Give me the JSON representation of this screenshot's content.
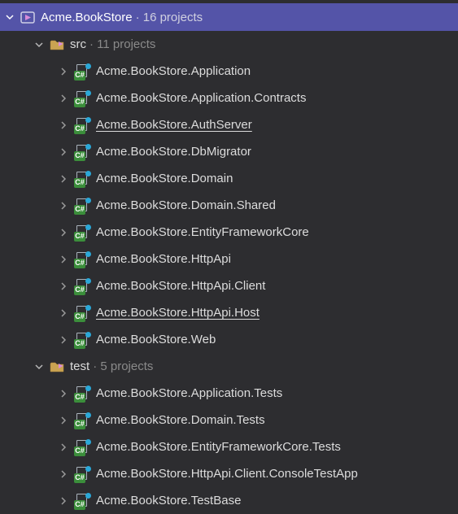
{
  "solution": {
    "name": "Acme.BookStore",
    "count_label": "16 projects"
  },
  "folders": [
    {
      "key": "src",
      "name": "src",
      "count_label": "11 projects",
      "expanded": true,
      "projects": [
        {
          "name": "Acme.BookStore.Application",
          "underline": false
        },
        {
          "name": "Acme.BookStore.Application.Contracts",
          "underline": false
        },
        {
          "name": "Acme.BookStore.AuthServer",
          "underline": true
        },
        {
          "name": "Acme.BookStore.DbMigrator",
          "underline": false
        },
        {
          "name": "Acme.BookStore.Domain",
          "underline": false
        },
        {
          "name": "Acme.BookStore.Domain.Shared",
          "underline": false
        },
        {
          "name": "Acme.BookStore.EntityFrameworkCore",
          "underline": false
        },
        {
          "name": "Acme.BookStore.HttpApi",
          "underline": false
        },
        {
          "name": "Acme.BookStore.HttpApi.Client",
          "underline": false
        },
        {
          "name": "Acme.BookStore.HttpApi.Host",
          "underline": true
        },
        {
          "name": "Acme.BookStore.Web",
          "underline": false
        }
      ]
    },
    {
      "key": "test",
      "name": "test",
      "count_label": "5 projects",
      "expanded": true,
      "projects": [
        {
          "name": "Acme.BookStore.Application.Tests",
          "underline": false
        },
        {
          "name": "Acme.BookStore.Domain.Tests",
          "underline": false
        },
        {
          "name": "Acme.BookStore.EntityFrameworkCore.Tests",
          "underline": false
        },
        {
          "name": "Acme.BookStore.HttpApi.Client.ConsoleTestApp",
          "underline": false
        },
        {
          "name": "Acme.BookStore.TestBase",
          "underline": false
        }
      ]
    }
  ],
  "badge_text": "C#"
}
